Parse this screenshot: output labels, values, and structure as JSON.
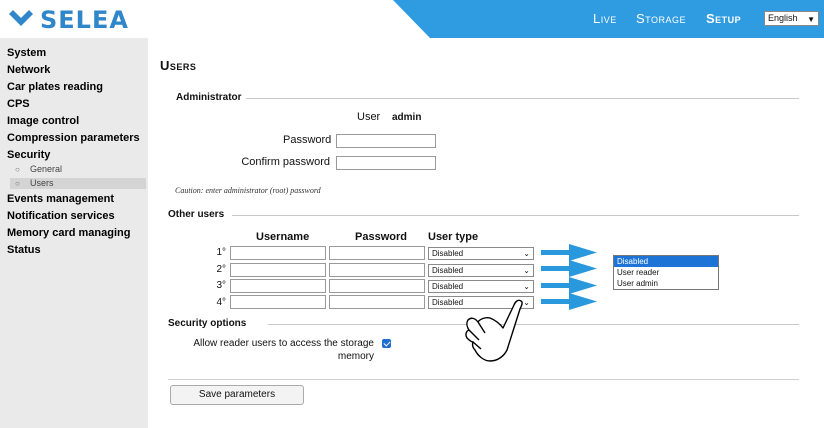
{
  "header": {
    "brand": "SELEA",
    "nav": {
      "live": "Live",
      "storage": "Storage",
      "setup": "Setup"
    },
    "language": "English",
    "accent_color": "#2f9be0"
  },
  "sidebar": {
    "items": [
      "System",
      "Network",
      "Car plates reading",
      "CPS",
      "Image control",
      "Compression parameters",
      "Security"
    ],
    "security_sub": [
      "General",
      "Users"
    ],
    "items_after": [
      "Events management",
      "Notification services",
      "Memory card managing",
      "Status"
    ],
    "active_sub": "Users"
  },
  "page": {
    "title": "Users"
  },
  "administrator": {
    "heading": "Administrator",
    "user_label": "User",
    "user_value": "admin",
    "password_label": "Password",
    "confirm_label": "Confirm password",
    "password_value": "",
    "confirm_value": "",
    "caution": "Caution: enter administrator (root) password"
  },
  "other_users": {
    "heading": "Other users",
    "columns": {
      "username": "Username",
      "password": "Password",
      "user_type": "User type"
    },
    "rows": [
      {
        "num": "1°",
        "username": "",
        "password": "",
        "user_type": "Disabled"
      },
      {
        "num": "2°",
        "username": "",
        "password": "",
        "user_type": "Disabled"
      },
      {
        "num": "3°",
        "username": "",
        "password": "",
        "user_type": "Disabled"
      },
      {
        "num": "4°",
        "username": "",
        "password": "",
        "user_type": "Disabled"
      }
    ],
    "dropdown_options": [
      "Disabled",
      "User reader",
      "User admin"
    ],
    "dropdown_selected": "Disabled"
  },
  "security_options": {
    "heading": "Security options",
    "allow_reader_line1": "Allow reader users to access the storage",
    "allow_reader_line2": "memory",
    "allow_reader_checked": true
  },
  "save_button": "Save parameters",
  "annotation": {
    "arrow_color": "#2a98dd",
    "pointer_icon": "hand-pointer-icon"
  }
}
